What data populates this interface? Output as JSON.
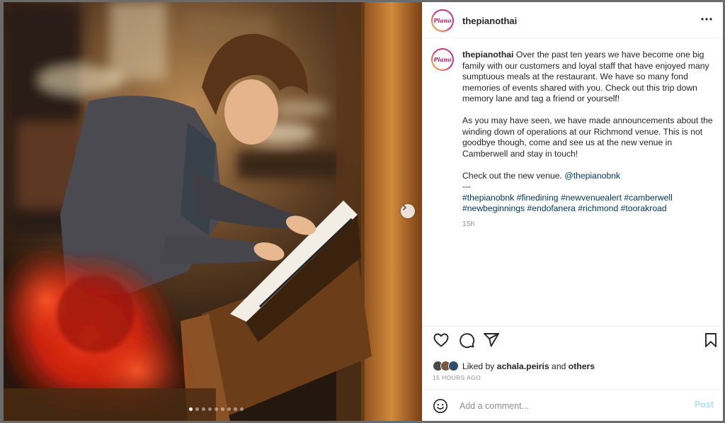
{
  "post": {
    "username": "thepianothai",
    "avatar_logo": "Piano",
    "caption_paragraphs": [
      "Over the past ten years we have become one big family with our customers and loyal staff that have enjoyed many sumptuous meals at the restaurant. We have so many fond memories of events shared with you. Check out this trip down memory lane and tag a friend or yourself!",
      "As you may have seen, we have made announcements about the winding down of operations at our Richmond venue. This is not goodbye though, come and see us at the new venue in Camberwell and stay in touch!"
    ],
    "venue_prefix": "Check out the new venue.",
    "venue_mention": "@thepianobnk",
    "separator": "---",
    "hashtags": [
      "#thepianobnk",
      "#finedining",
      "#newvenuealert",
      "#camberwell",
      "#newbeginnings",
      "#endofanera",
      "#richmond",
      "#toorakroad"
    ],
    "time_ago": "15h",
    "liked_by_prefix": "Liked by",
    "liked_by_user": "achala.peiris",
    "liked_by_and": "and",
    "liked_by_others": "others",
    "posted_ago": "15 HOURS AGO"
  },
  "comment": {
    "placeholder": "Add a comment...",
    "post_label": "Post"
  },
  "carousel": {
    "total": 9,
    "active_index": 0
  },
  "icons": {
    "more": "more-options-icon",
    "like": "heart-icon",
    "comment": "comment-icon",
    "share": "share-icon",
    "save": "bookmark-icon",
    "emoji": "emoji-icon",
    "next": "chevron-right-icon"
  },
  "colors": {
    "link": "#00376b",
    "muted": "#8e8e8e",
    "post_disabled": "#b2dffc"
  }
}
